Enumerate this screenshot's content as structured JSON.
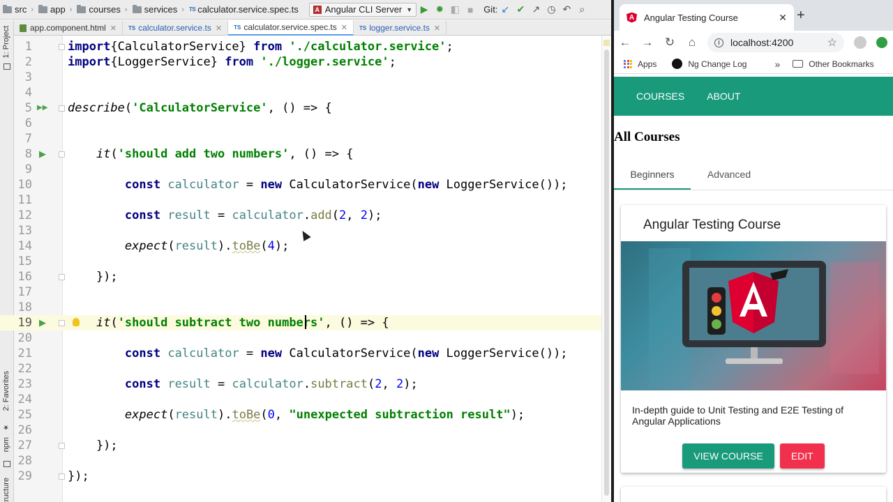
{
  "ide": {
    "breadcrumbs": [
      "src",
      "app",
      "courses",
      "services"
    ],
    "breadcrumb_file": "calculator.service.spec.ts",
    "run_config": "Angular CLI Server",
    "git_label": "Git:",
    "tabs": [
      {
        "label": "app.component.html",
        "type": "html"
      },
      {
        "label": "calculator.service.ts",
        "type": "ts"
      },
      {
        "label": "calculator.service.spec.ts",
        "type": "ts",
        "active": true
      },
      {
        "label": "logger.service.ts",
        "type": "ts"
      }
    ],
    "side_panels": [
      "1: Project",
      "2: Favorites",
      "npm",
      "Structure"
    ],
    "current_line": 19,
    "code_lines": [
      {
        "n": "1",
        "tokens": [
          [
            "kw",
            "import"
          ],
          [
            "",
            "{CalculatorService} "
          ],
          [
            "kw",
            "from"
          ],
          [
            "",
            " "
          ],
          [
            "str",
            "'./calculator.service'"
          ],
          [
            "",
            ";"
          ]
        ]
      },
      {
        "n": "2",
        "tokens": [
          [
            "kw",
            "import"
          ],
          [
            "",
            "{LoggerService} "
          ],
          [
            "kw",
            "from"
          ],
          [
            "",
            " "
          ],
          [
            "str",
            "'./logger.service'"
          ],
          [
            "",
            ";"
          ]
        ]
      },
      {
        "n": "3",
        "tokens": []
      },
      {
        "n": "4",
        "tokens": []
      },
      {
        "n": "5",
        "tokens": [
          [
            "it",
            "describe"
          ],
          [
            "",
            "("
          ],
          [
            "str",
            "'CalculatorService'"
          ],
          [
            "",
            ", () => {"
          ]
        ]
      },
      {
        "n": "6",
        "tokens": []
      },
      {
        "n": "7",
        "tokens": []
      },
      {
        "n": "8",
        "tokens": [
          [
            "",
            "    "
          ],
          [
            "it",
            "it"
          ],
          [
            "",
            "("
          ],
          [
            "str",
            "'should add two numbers'"
          ],
          [
            "",
            ", () => {"
          ]
        ]
      },
      {
        "n": "9",
        "tokens": []
      },
      {
        "n": "10",
        "tokens": [
          [
            "",
            "        "
          ],
          [
            "kw",
            "const"
          ],
          [
            "",
            " "
          ],
          [
            "var",
            "calculator"
          ],
          [
            "",
            " = "
          ],
          [
            "kw",
            "new"
          ],
          [
            "",
            " CalculatorService("
          ],
          [
            "kw",
            "new"
          ],
          [
            "",
            " LoggerService());"
          ]
        ]
      },
      {
        "n": "11",
        "tokens": []
      },
      {
        "n": "12",
        "tokens": [
          [
            "",
            "        "
          ],
          [
            "kw",
            "const"
          ],
          [
            "",
            " "
          ],
          [
            "var",
            "result"
          ],
          [
            "",
            " = "
          ],
          [
            "var",
            "calculator"
          ],
          [
            "",
            "."
          ],
          [
            "fn",
            "add"
          ],
          [
            "",
            "("
          ],
          [
            "num",
            "2"
          ],
          [
            "",
            ", "
          ],
          [
            "num",
            "2"
          ],
          [
            "",
            ");"
          ]
        ]
      },
      {
        "n": "13",
        "tokens": []
      },
      {
        "n": "14",
        "tokens": [
          [
            "",
            "        "
          ],
          [
            "it",
            "expect"
          ],
          [
            "",
            "("
          ],
          [
            "var",
            "result"
          ],
          [
            "",
            ")."
          ],
          [
            "fnw",
            "toBe"
          ],
          [
            "",
            "("
          ],
          [
            "num",
            "4"
          ],
          [
            "",
            ");"
          ]
        ]
      },
      {
        "n": "15",
        "tokens": []
      },
      {
        "n": "16",
        "tokens": [
          [
            "",
            "    });"
          ]
        ]
      },
      {
        "n": "17",
        "tokens": []
      },
      {
        "n": "18",
        "tokens": []
      },
      {
        "n": "19",
        "tokens": [
          [
            "",
            "    "
          ],
          [
            "it",
            "it"
          ],
          [
            "",
            "("
          ],
          [
            "str",
            "'should subtract two numbers'"
          ],
          [
            "",
            ", () => {"
          ]
        ]
      },
      {
        "n": "20",
        "tokens": []
      },
      {
        "n": "21",
        "tokens": [
          [
            "",
            "        "
          ],
          [
            "kw",
            "const"
          ],
          [
            "",
            " "
          ],
          [
            "var",
            "calculator"
          ],
          [
            "",
            " = "
          ],
          [
            "kw",
            "new"
          ],
          [
            "",
            " CalculatorService("
          ],
          [
            "kw",
            "new"
          ],
          [
            "",
            " LoggerService());"
          ]
        ]
      },
      {
        "n": "22",
        "tokens": []
      },
      {
        "n": "23",
        "tokens": [
          [
            "",
            "        "
          ],
          [
            "kw",
            "const"
          ],
          [
            "",
            " "
          ],
          [
            "var",
            "result"
          ],
          [
            "",
            " = "
          ],
          [
            "var",
            "calculator"
          ],
          [
            "",
            "."
          ],
          [
            "fn",
            "subtract"
          ],
          [
            "",
            "("
          ],
          [
            "num",
            "2"
          ],
          [
            "",
            ", "
          ],
          [
            "num",
            "2"
          ],
          [
            "",
            ");"
          ]
        ]
      },
      {
        "n": "24",
        "tokens": []
      },
      {
        "n": "25",
        "tokens": [
          [
            "",
            "        "
          ],
          [
            "it",
            "expect"
          ],
          [
            "",
            "("
          ],
          [
            "var",
            "result"
          ],
          [
            "",
            ")."
          ],
          [
            "fnw",
            "toBe"
          ],
          [
            "",
            "("
          ],
          [
            "num",
            "0"
          ],
          [
            "",
            ", "
          ],
          [
            "str",
            "\"unexpected subtraction result\""
          ],
          [
            "",
            ");"
          ]
        ]
      },
      {
        "n": "26",
        "tokens": []
      },
      {
        "n": "27",
        "tokens": [
          [
            "",
            "    });"
          ]
        ]
      },
      {
        "n": "28",
        "tokens": []
      },
      {
        "n": "29",
        "tokens": [
          [
            "",
            "});"
          ]
        ]
      }
    ],
    "run_marker_lines": [
      5,
      8,
      19
    ],
    "fold_marker_lines": [
      1,
      5,
      8,
      16,
      19,
      27,
      29
    ],
    "bulb_line": 19
  },
  "browser": {
    "tab_title": "Angular Testing Course",
    "url": "localhost:4200",
    "bookmarks": {
      "apps": "Apps",
      "ng_change_log": "Ng Change Log",
      "other": "Other Bookmarks"
    },
    "app": {
      "nav": [
        "COURSES",
        "ABOUT"
      ],
      "heading": "All Courses",
      "tabs": [
        "Beginners",
        "Advanced"
      ],
      "active_tab": "Beginners",
      "card": {
        "title": "Angular Testing Course",
        "description": "In-depth guide to Unit Testing and E2E Testing of Angular Applications",
        "view_button": "VIEW COURSE",
        "edit_button": "EDIT"
      }
    }
  },
  "colors": {
    "primary": "#189a7b",
    "warn": "#f0304c",
    "angular_red": "#dd0031",
    "current_line_bg": "#fcfadf"
  }
}
